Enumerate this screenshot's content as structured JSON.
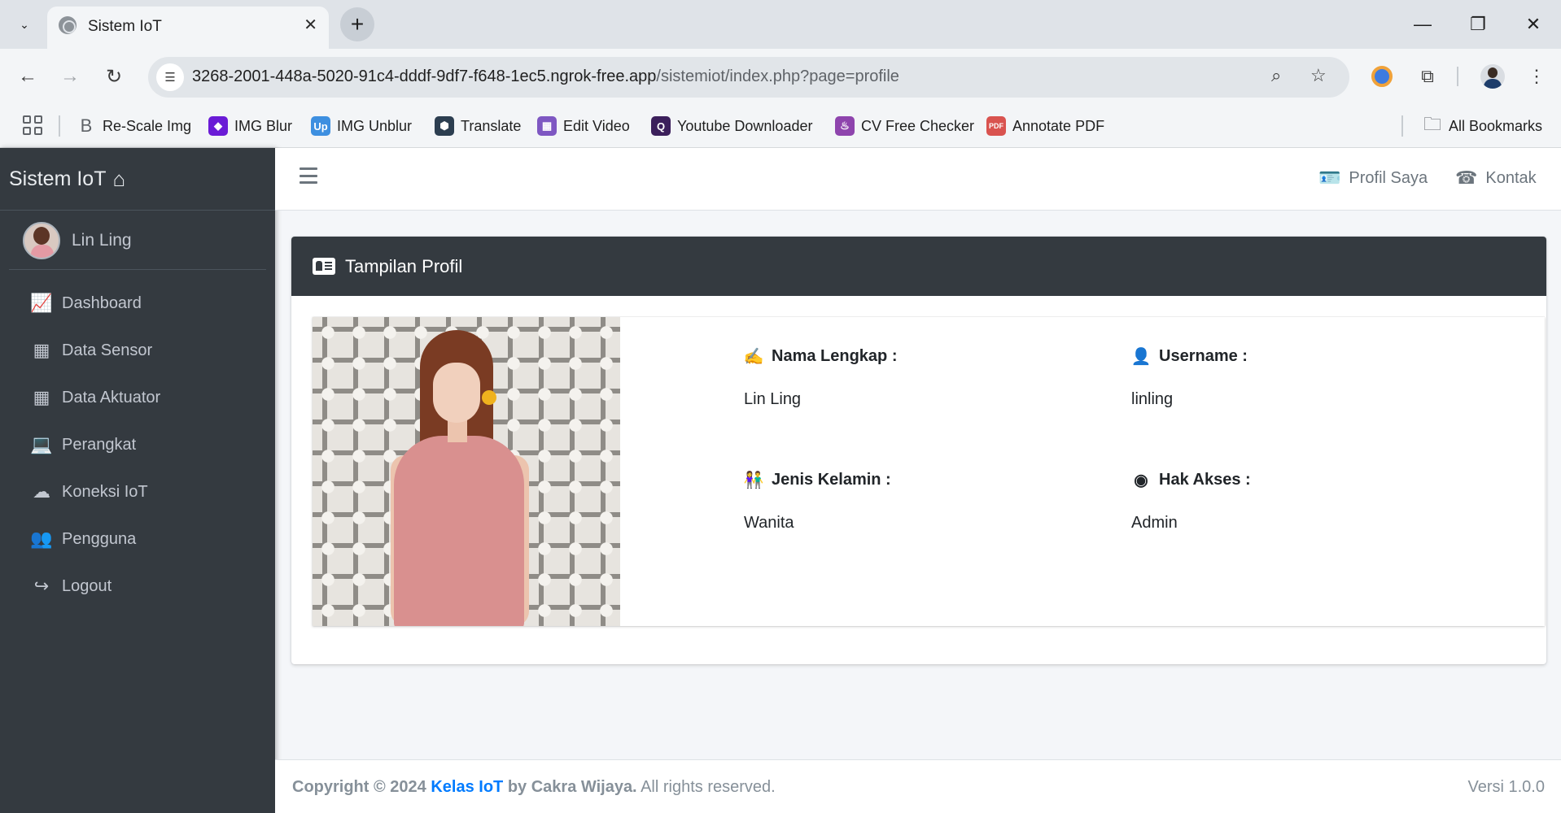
{
  "browser": {
    "tab_title": "Sistem IoT",
    "url_host": "3268-2001-448a-5020-91c4-dddf-9df7-f648-1ec5.ngrok-free.app",
    "url_path": "/sistemiot/index.php?page=profile",
    "bookmarks": [
      {
        "label": "Re-Scale Img",
        "icon": "rescale-icon",
        "color": "#5f6368"
      },
      {
        "label": "IMG Blur",
        "icon": "img-blur-icon",
        "color": "#6a1bd6"
      },
      {
        "label": "IMG Unblur",
        "icon": "img-unblur-icon",
        "color": "#3d8fe0"
      },
      {
        "label": "Translate",
        "icon": "translate-icon",
        "color": "#2c3e50"
      },
      {
        "label": "Edit Video",
        "icon": "edit-video-icon",
        "color": "#7e57c2"
      },
      {
        "label": "Youtube Downloader",
        "icon": "youtube-downloader-icon",
        "color": "#3b1f5b"
      },
      {
        "label": "CV Free Checker",
        "icon": "cv-checker-icon",
        "color": "#8e44ad"
      },
      {
        "label": "Annotate PDF",
        "icon": "annotate-pdf-icon",
        "color": "#d9534f"
      }
    ],
    "all_bookmarks": "All Bookmarks"
  },
  "sidebar": {
    "brand": "Sistem IoT",
    "user_name": "Lin Ling",
    "items": [
      {
        "label": "Dashboard",
        "icon": "chart-area-icon"
      },
      {
        "label": "Data Sensor",
        "icon": "grid-icon"
      },
      {
        "label": "Data Aktuator",
        "icon": "grid-icon"
      },
      {
        "label": "Perangkat",
        "icon": "laptop-icon"
      },
      {
        "label": "Koneksi IoT",
        "icon": "cloud-icon"
      },
      {
        "label": "Pengguna",
        "icon": "users-icon"
      },
      {
        "label": "Logout",
        "icon": "sign-out-icon"
      }
    ]
  },
  "topnav": {
    "profile_label": "Profil Saya",
    "contact_label": "Kontak"
  },
  "card": {
    "title": "Tampilan Profil",
    "fields": {
      "full_name_label": "Nama Lengkap :",
      "full_name_value": "Lin Ling",
      "username_label": "Username :",
      "username_value": "linling",
      "gender_label": "Jenis Kelamin :",
      "gender_value": "Wanita",
      "access_label": "Hak Akses :",
      "access_value": "Admin"
    }
  },
  "footer": {
    "copyright_prefix": "Copyright © 2024",
    "link_text": "Kelas IoT",
    "by_text": "by Cakra Wijaya.",
    "rights": "All rights reserved.",
    "version": "Versi 1.0.0"
  },
  "colors": {
    "sidebar_bg": "#343a40",
    "content_bg": "#f4f6f9",
    "link": "#007bff"
  }
}
